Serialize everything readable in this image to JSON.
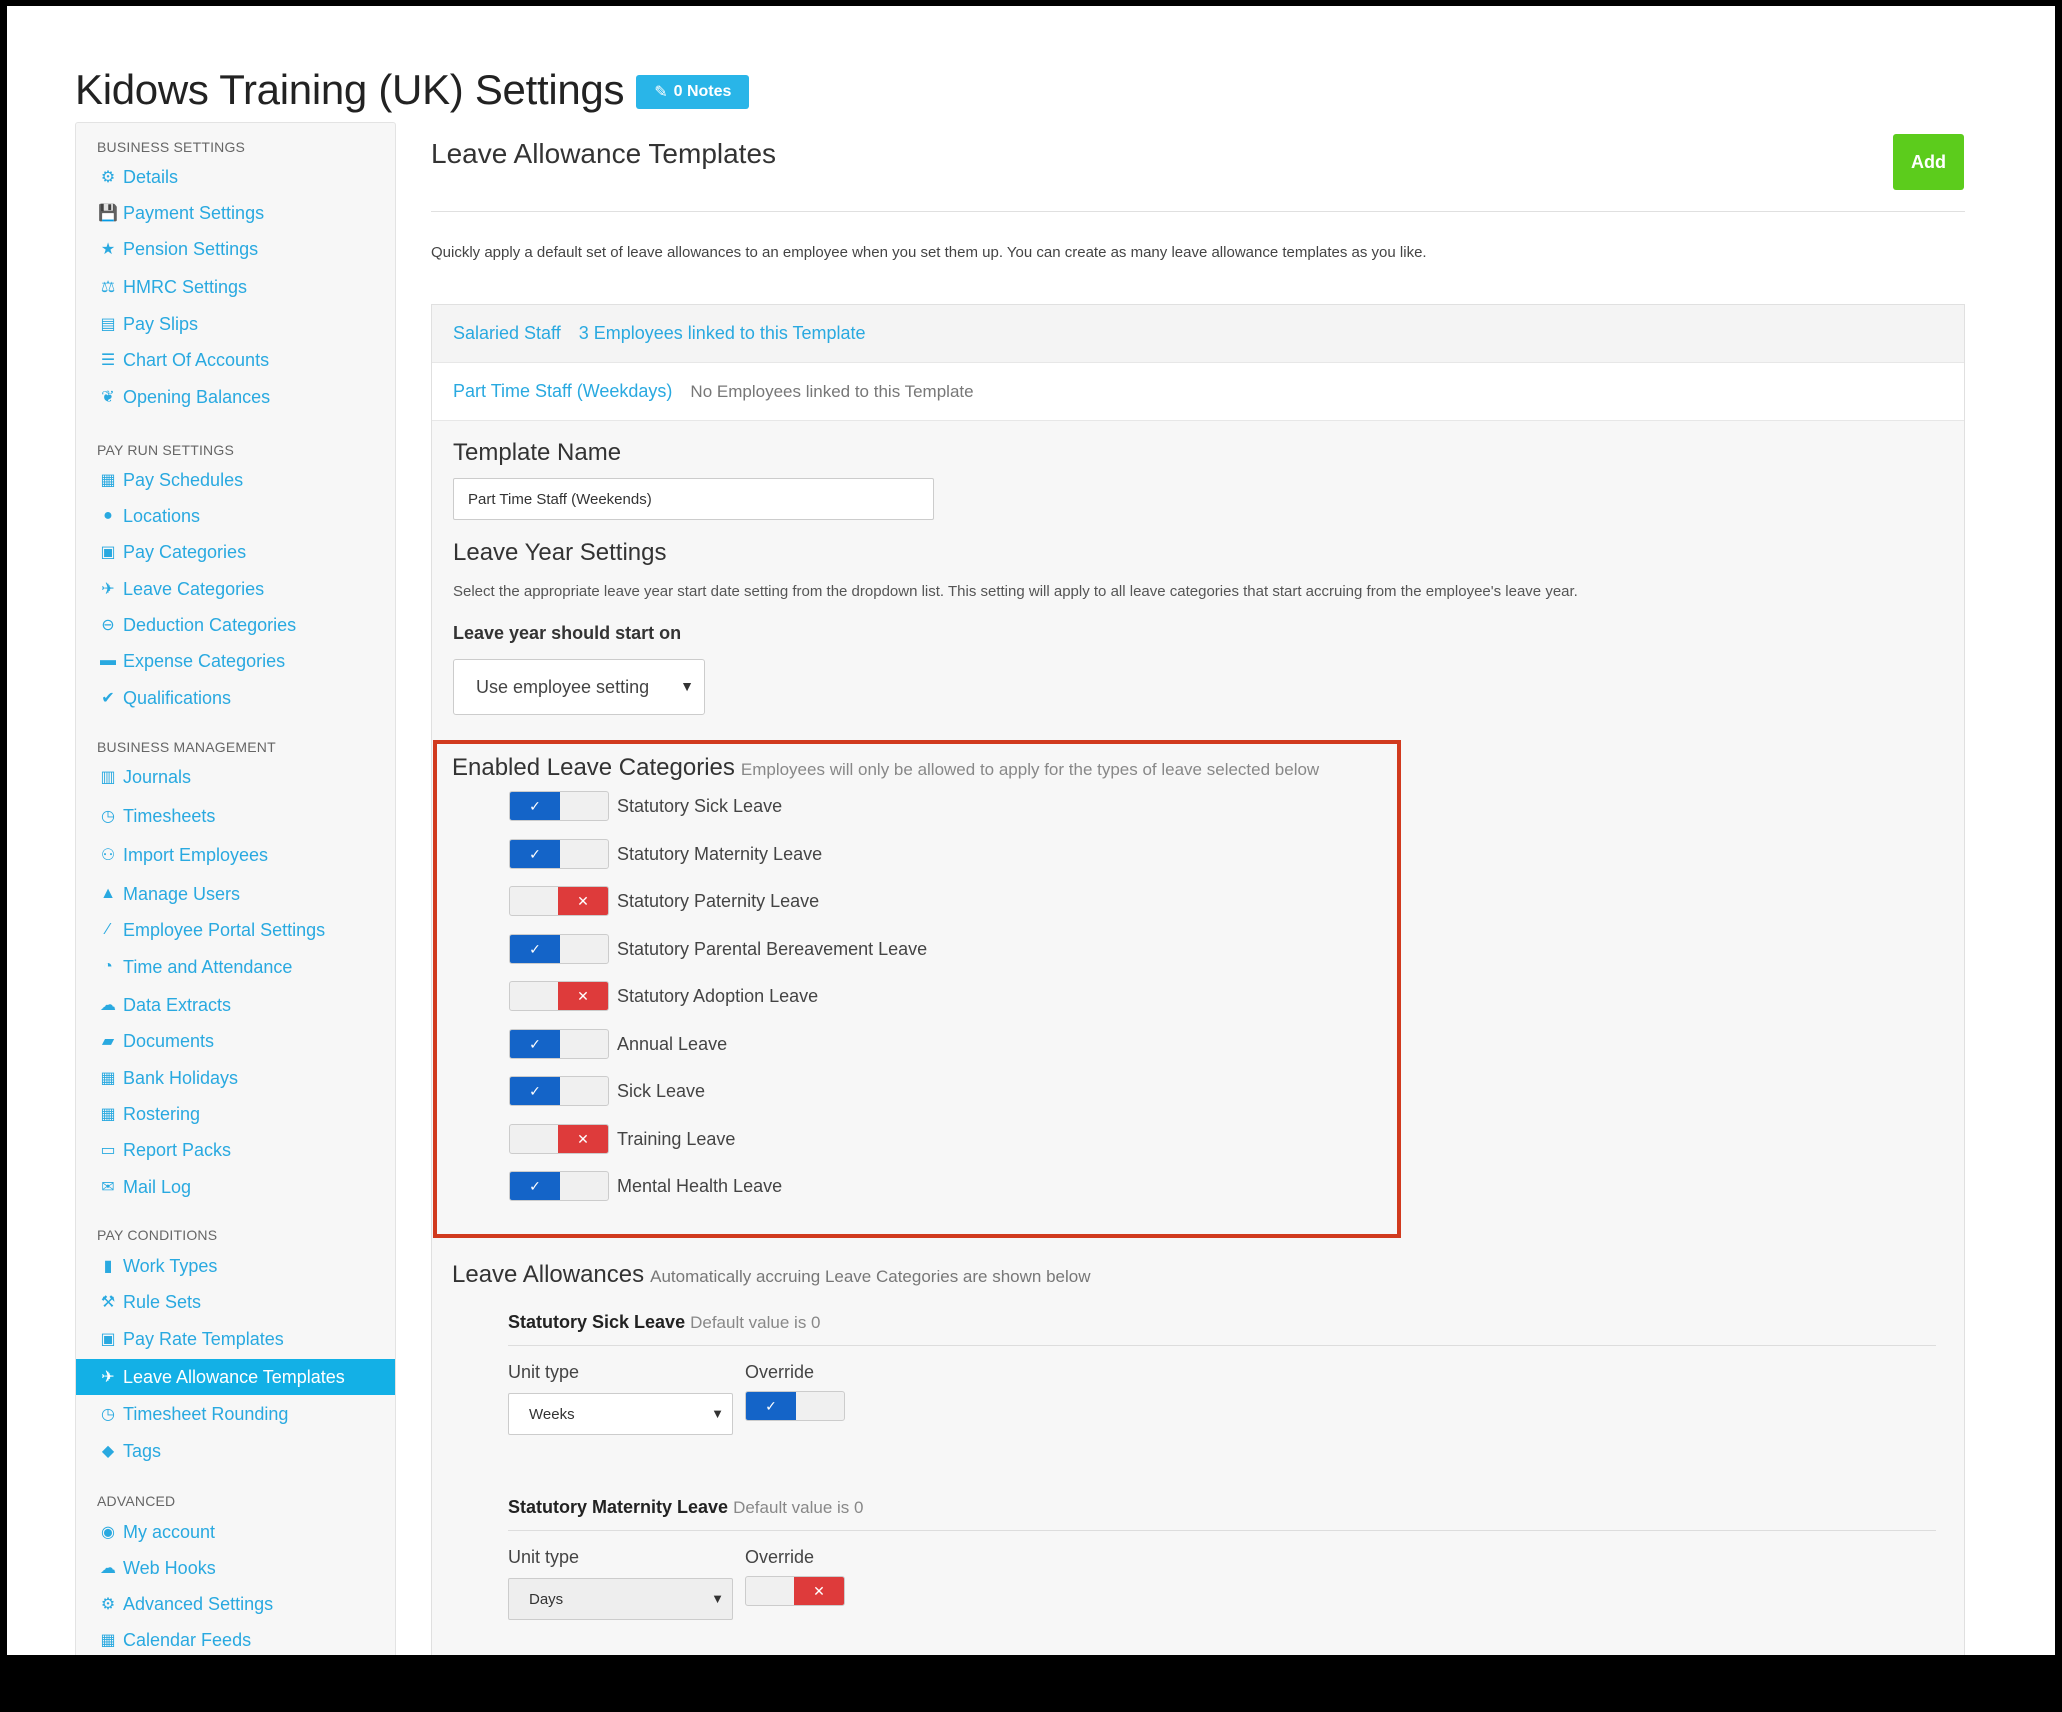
{
  "page": {
    "title": "Kidows Training (UK) Settings",
    "notes_label": "0 Notes"
  },
  "sidebar": {
    "sections": [
      {
        "label": "BUSINESS SETTINGS",
        "items": [
          {
            "label": "Details",
            "icon": "gear-icon"
          },
          {
            "label": "Payment Settings",
            "icon": "save-icon"
          },
          {
            "label": "Pension Settings",
            "icon": "star-icon"
          },
          {
            "label": "HMRC Settings",
            "icon": "scale-icon"
          },
          {
            "label": "Pay Slips",
            "icon": "file-icon"
          },
          {
            "label": "Chart Of Accounts",
            "icon": "list-icon"
          },
          {
            "label": "Opening Balances",
            "icon": "leaf-icon"
          }
        ]
      },
      {
        "label": "PAY RUN SETTINGS",
        "items": [
          {
            "label": "Pay Schedules",
            "icon": "calendar-icon"
          },
          {
            "label": "Locations",
            "icon": "globe-icon"
          },
          {
            "label": "Pay Categories",
            "icon": "money-icon"
          },
          {
            "label": "Leave Categories",
            "icon": "plane-icon"
          },
          {
            "label": "Deduction Categories",
            "icon": "minus-circle-icon"
          },
          {
            "label": "Expense Categories",
            "icon": "calculator-icon"
          },
          {
            "label": "Qualifications",
            "icon": "check-icon"
          }
        ]
      },
      {
        "label": "BUSINESS MANAGEMENT",
        "items": [
          {
            "label": "Journals",
            "icon": "columns-icon"
          },
          {
            "label": "Timesheets",
            "icon": "clock-icon"
          },
          {
            "label": "Import Employees",
            "icon": "people-icon"
          },
          {
            "label": "Manage Users",
            "icon": "lock-icon"
          },
          {
            "label": "Employee Portal Settings",
            "icon": "magic-wand-icon"
          },
          {
            "label": "Time and Attendance",
            "icon": "user-clock-icon"
          },
          {
            "label": "Data Extracts",
            "icon": "cloud-download-icon"
          },
          {
            "label": "Documents",
            "icon": "folder-icon"
          },
          {
            "label": "Bank Holidays",
            "icon": "calendar-icon"
          },
          {
            "label": "Rostering",
            "icon": "calendar-icon"
          },
          {
            "label": "Report Packs",
            "icon": "folder-open-icon"
          },
          {
            "label": "Mail Log",
            "icon": "envelope-icon"
          }
        ]
      },
      {
        "label": "PAY CONDITIONS",
        "items": [
          {
            "label": "Work Types",
            "icon": "book-icon"
          },
          {
            "label": "Rule Sets",
            "icon": "gavel-icon"
          },
          {
            "label": "Pay Rate Templates",
            "icon": "money-icon"
          },
          {
            "label": "Leave Allowance Templates",
            "icon": "plane-icon",
            "active": true
          },
          {
            "label": "Timesheet Rounding",
            "icon": "clock-icon"
          },
          {
            "label": "Tags",
            "icon": "tag-icon"
          }
        ]
      },
      {
        "label": "ADVANCED",
        "items": [
          {
            "label": "My account",
            "icon": "user-circle-icon"
          },
          {
            "label": "Web Hooks",
            "icon": "cloud-icon"
          },
          {
            "label": "Advanced Settings",
            "icon": "gear-icon"
          },
          {
            "label": "Calendar Feeds",
            "icon": "calendar-icon"
          }
        ]
      }
    ]
  },
  "main": {
    "heading": "Leave Allowance Templates",
    "add_label": "Add",
    "description": "Quickly apply a default set of leave allowances to an employee when you set them up. You can create as many leave allowance templates as you like.",
    "templates": [
      {
        "name": "Salaried Staff",
        "link": "3 Employees linked to this Template"
      },
      {
        "name": "Part Time Staff (Weekdays)",
        "link": "No Employees linked to this Template"
      }
    ],
    "form": {
      "template_name_label": "Template Name",
      "template_name_value": "Part Time Staff (Weekends)",
      "leave_year_label": "Leave Year Settings",
      "leave_year_desc": "Select the appropriate leave year start date setting from the dropdown list. This setting will apply to all leave categories that start accruing from the employee's leave year.",
      "start_on_label": "Leave year should start on",
      "start_on_value": "Use employee setting"
    },
    "enabled": {
      "title": "Enabled Leave Categories",
      "subtitle": "Employees will only be allowed to apply for the types of leave selected below",
      "categories": [
        {
          "label": "Statutory Sick Leave",
          "enabled": true
        },
        {
          "label": "Statutory Maternity Leave",
          "enabled": true
        },
        {
          "label": "Statutory Paternity Leave",
          "enabled": false
        },
        {
          "label": "Statutory Parental Bereavement Leave",
          "enabled": true
        },
        {
          "label": "Statutory Adoption Leave",
          "enabled": false
        },
        {
          "label": "Annual Leave",
          "enabled": true
        },
        {
          "label": "Sick Leave",
          "enabled": true
        },
        {
          "label": "Training Leave",
          "enabled": false
        },
        {
          "label": "Mental Health Leave",
          "enabled": true
        }
      ]
    },
    "allowances": {
      "title": "Leave Allowances",
      "subtitle": "Automatically accruing Leave Categories are shown below",
      "unit_type_label": "Unit type",
      "override_label": "Override",
      "items": [
        {
          "name": "Statutory Sick Leave",
          "default": "Default value is 0",
          "unit": "Weeks",
          "override": true
        },
        {
          "name": "Statutory Maternity Leave",
          "default": "Default value is 0",
          "unit": "Days",
          "override": false
        }
      ]
    }
  },
  "colors": {
    "accent": "#29a9e0",
    "active_bg": "#13b0e6",
    "add_green": "#5ccc1c",
    "toggle_on": "#1464c8",
    "toggle_off": "#de3b3b",
    "highlight_border": "#d13a1e"
  }
}
